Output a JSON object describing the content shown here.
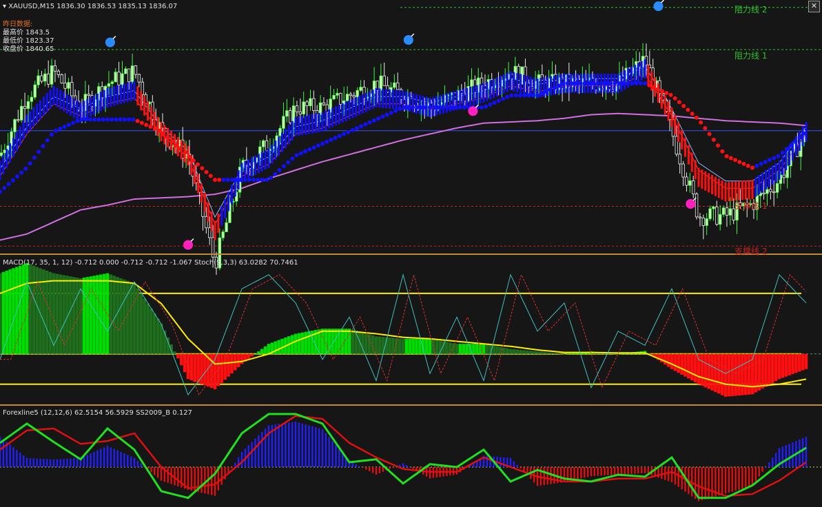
{
  "header": {
    "symbol_line": "XAUUSD,M15  1836.30 1836.53 1835.13 1836.07",
    "prev_day_title": "昨日数据:",
    "prev_high": "最高价 1843.5",
    "prev_low": "最低价 1823.37",
    "prev_close": "收盘价 1840.65"
  },
  "levels": {
    "resist_2": "阻力线 2",
    "resist_1": "阻力线 1",
    "support_1": "支撑线 1",
    "support_2": "支撑线 2"
  },
  "macd_label": "MACD(17, 35, 1, 12) -0.712 0.000 -0.712 -0.712 -1.067  Stoch(9,3,3) 63.0282 70.7461",
  "forex_label": "Forexline5 (12,12,6) 62.5154 56.5929  SS2009_B 0.127",
  "colors": {
    "background": "#161616",
    "separator": "#c08a3a",
    "resist_line": "#2ec42e",
    "support_line": "#d42020",
    "bull_candle": "#c8ffb0",
    "bear_candle": "#f0f0f0",
    "dots_blue": "#1010ff",
    "dots_red": "#ff1010",
    "ma_magenta": "#d070e0",
    "macd_green": "#00dd00",
    "macd_dark": "#1e6e1e",
    "macd_red": "#ff1010",
    "signal_yellow": "#ffee00",
    "stoch_cyan": "#40c0c0",
    "forex_green": "#20e020",
    "forex_red": "#e01010",
    "hist_blue": "#2020ff"
  },
  "chart_data": [
    {
      "type": "line",
      "panel": "price",
      "title": "XAUUSD,M15",
      "x": [
        0,
        10,
        20,
        30,
        40,
        50,
        60,
        70,
        80,
        90,
        100,
        110,
        120,
        130,
        140,
        150,
        160,
        170,
        180,
        190,
        200,
        210,
        220,
        230,
        240,
        250,
        260,
        270,
        280,
        290,
        300
      ],
      "series": [
        {
          "values": [
            1834,
            1839,
            1841,
            1838,
            1840,
            1841,
            1836,
            1834,
            1825,
            1833,
            1835,
            1838,
            1838,
            1839,
            1840,
            1839,
            1838,
            1839,
            1840,
            1841,
            1840,
            1840,
            1840,
            1840,
            1842,
            1836,
            1829,
            1829,
            1830,
            1832,
            1836
          ]
        },
        {
          "values": [
            1831,
            1833,
            1836,
            1837,
            1837,
            1837,
            1836,
            1834,
            1832,
            1832,
            1832,
            1834,
            1835,
            1836,
            1837,
            1838,
            1838,
            1838,
            1838,
            1839,
            1839,
            1840,
            1840,
            1840,
            1840,
            1839,
            1837,
            1834,
            1833,
            1834,
            1836
          ]
        },
        {
          "values": [
            1827,
            1827.5,
            1828.5,
            1829.5,
            1829.9,
            1830.4,
            1830.5,
            1830.6,
            1830.8,
            1831.3,
            1832.1,
            1832.8,
            1833.5,
            1834.1,
            1834.7,
            1835.3,
            1835.8,
            1836.3,
            1836.7,
            1836.8,
            1836.9,
            1837.1,
            1837.4,
            1837.5,
            1837.4,
            1837.3,
            1837.1,
            1836.9,
            1836.8,
            1836.7,
            1836.5
          ]
        }
      ],
      "levels": {
        "resist_2": 1846.3,
        "resist_1": 1842.8,
        "support_1": 1829.8,
        "support_2": 1826.5,
        "current": 1836.07
      },
      "ylim": [
        1826,
        1846.8
      ]
    },
    {
      "type": "bar",
      "panel": "macd",
      "x": [
        0,
        10,
        20,
        30,
        40,
        50,
        60,
        70,
        80,
        90,
        100,
        110,
        120,
        130,
        140,
        150,
        160,
        170,
        180,
        190,
        200,
        210,
        220,
        230,
        240,
        250,
        260,
        270,
        280,
        290,
        300
      ],
      "series": [
        {
          "values": [
            1.6,
            1.8,
            1.6,
            1.5,
            1.6,
            1.4,
            0.6,
            -0.5,
            -0.7,
            -0.2,
            0.2,
            0.4,
            0.5,
            0.5,
            0.35,
            0.3,
            0.3,
            0.2,
            0.2,
            0.1,
            0.05,
            0.0,
            0.05,
            0.0,
            0.06,
            -0.3,
            -0.6,
            -0.85,
            -0.8,
            -0.5,
            -0.3
          ]
        },
        {
          "values": [
            1.2,
            1.4,
            1.45,
            1.45,
            1.45,
            1.4,
            1.0,
            0.3,
            -0.2,
            -0.15,
            0.0,
            0.25,
            0.45,
            0.45,
            0.4,
            0.33,
            0.3,
            0.25,
            0.2,
            0.15,
            0.08,
            0.03,
            0.03,
            0.02,
            0.02,
            -0.2,
            -0.45,
            -0.6,
            -0.65,
            -0.6,
            -0.5
          ]
        }
      ],
      "stoch": [
        30,
        85,
        40,
        80,
        50,
        85,
        55,
        5,
        30,
        80,
        90,
        70,
        30,
        60,
        15,
        90,
        20,
        60,
        15,
        90,
        50,
        70,
        10,
        50,
        40,
        80,
        30,
        20,
        30,
        90,
        70
      ],
      "levels": [
        1.2,
        0.0,
        -0.6
      ],
      "ylim": [
        -1.0,
        1.95
      ]
    },
    {
      "type": "line",
      "panel": "forexline",
      "x": [
        0,
        10,
        20,
        30,
        40,
        50,
        60,
        70,
        80,
        90,
        100,
        110,
        120,
        130,
        140,
        150,
        160,
        170,
        180,
        190,
        200,
        210,
        220,
        230,
        240,
        250,
        260,
        270,
        280,
        290,
        300
      ],
      "series": [
        {
          "values": [
            65,
            85,
            66,
            48,
            80,
            58,
            15,
            8,
            33,
            75,
            95,
            95,
            85,
            45,
            48,
            23,
            43,
            40,
            58,
            25,
            37,
            28,
            25,
            32,
            30,
            50,
            8,
            8,
            21,
            43,
            60
          ]
        },
        {
          "values": [
            58,
            78,
            80,
            64,
            67,
            75,
            40,
            18,
            22,
            45,
            75,
            93,
            90,
            65,
            50,
            38,
            35,
            35,
            50,
            40,
            30,
            25,
            25,
            28,
            28,
            35,
            20,
            10,
            12,
            26,
            45
          ]
        }
      ],
      "histogram": [
        40,
        12,
        10,
        12,
        28,
        12,
        -18,
        -30,
        -38,
        20,
        55,
        60,
        50,
        8,
        -10,
        5,
        -15,
        -10,
        15,
        12,
        -25,
        -20,
        -12,
        -10,
        -8,
        -20,
        -45,
        -35,
        -25,
        25,
        40
      ],
      "ylim": [
        0,
        100
      ]
    }
  ]
}
